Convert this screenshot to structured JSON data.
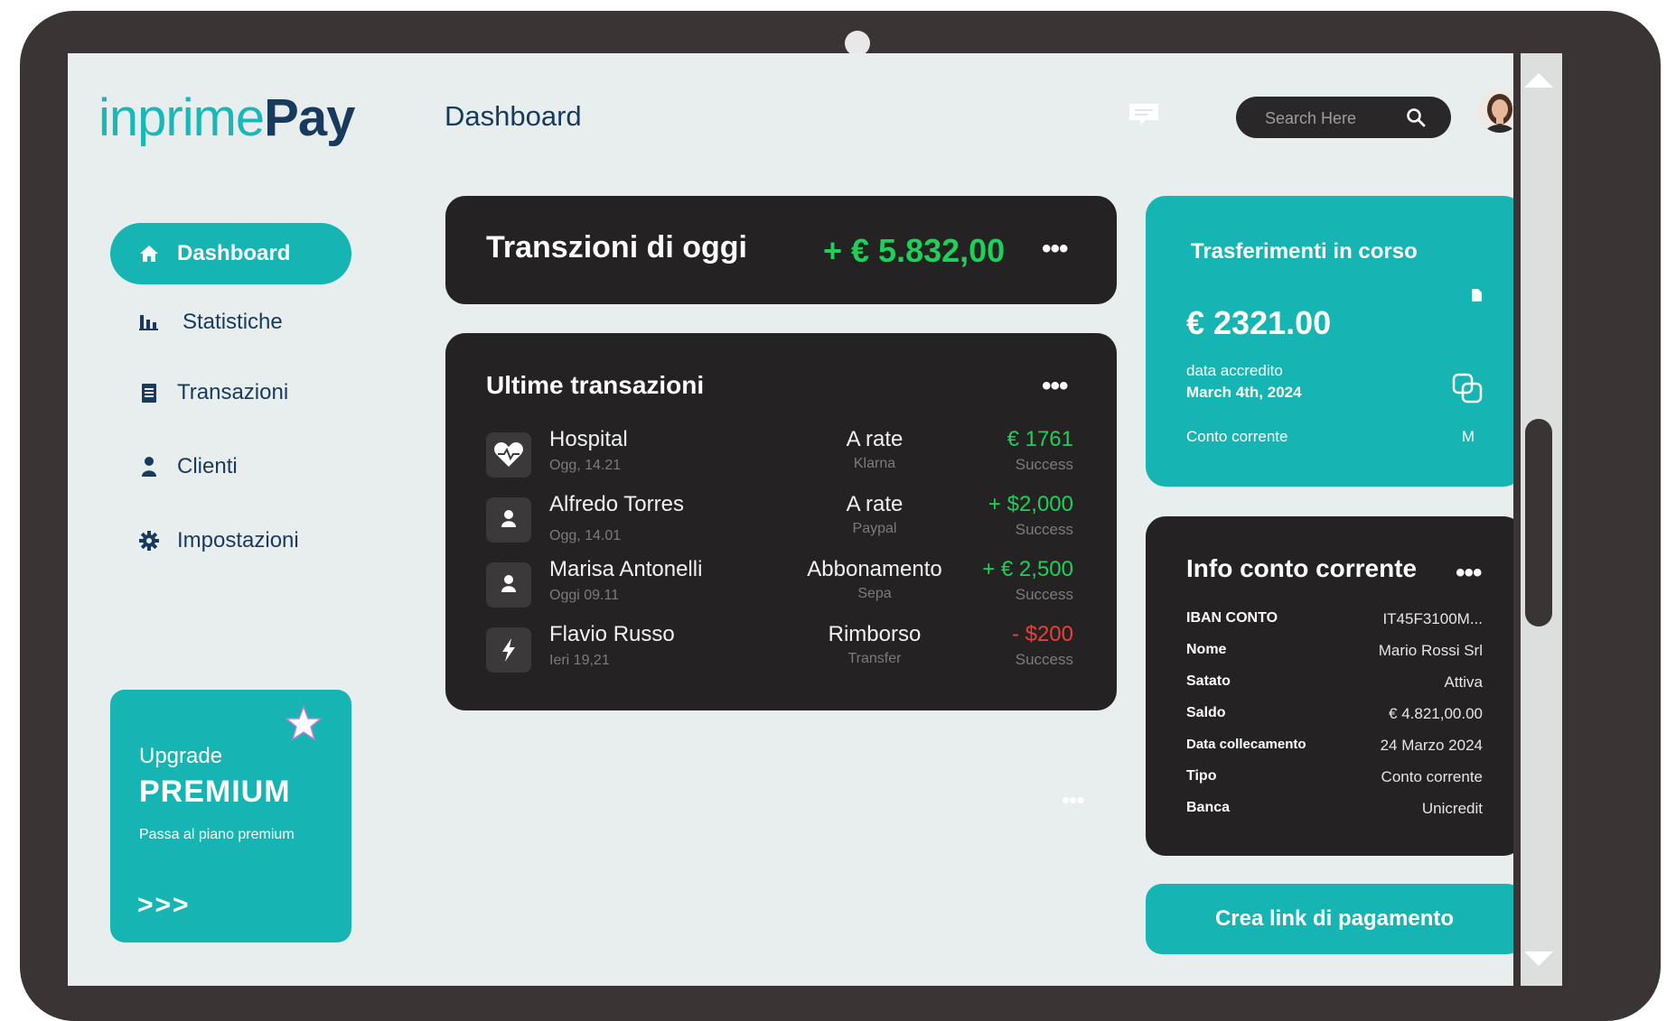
{
  "brand": {
    "part1": "inprime",
    "part2": "Pay"
  },
  "header": {
    "title": "Dashboard",
    "search_placeholder": "Search Here"
  },
  "sidebar": {
    "items": [
      {
        "label": "Dashboard",
        "icon": "home-icon",
        "active": true
      },
      {
        "label": "Statistiche",
        "icon": "bar-chart-icon"
      },
      {
        "label": "Transazioni",
        "icon": "document-icon"
      },
      {
        "label": "Clienti",
        "icon": "user-icon"
      },
      {
        "label": "Impostazioni",
        "icon": "gear-icon"
      }
    ]
  },
  "upgrade": {
    "line1": "Upgrade",
    "line2": "PREMIUM",
    "line3": "Passa al piano premium",
    "arrows": ">>>"
  },
  "today": {
    "title": "Transzioni di oggi",
    "amount": "+ € 5.832,00",
    "more": "•••"
  },
  "recent": {
    "title": "Ultime  transazioni",
    "more": "•••",
    "rows": [
      {
        "icon": "heart-pulse-icon",
        "name": "Hospital",
        "time": "Ogg, 14.21",
        "method": "A rate",
        "provider": "Klarna",
        "amount": "€ 1761",
        "status": "Success",
        "tone": "green"
      },
      {
        "icon": "user-icon",
        "name": "Alfredo Torres",
        "time": "Ogg, 14.01",
        "method": "A rate",
        "provider": "Paypal",
        "amount": "+ $2,000",
        "status": "Success",
        "tone": "green"
      },
      {
        "icon": "user-icon",
        "name": "Marisa Antonelli",
        "time": "Oggi 09.11",
        "method": "Abbonamento",
        "provider": "Sepa",
        "amount": "+ € 2,500",
        "status": "Success",
        "tone": "green"
      },
      {
        "icon": "lightning-icon",
        "name": "Flavio Russo",
        "time": "Ieri 19,21",
        "method": "Rimborso",
        "provider": "Transfer",
        "amount": "- $200",
        "status": "Success",
        "tone": "red"
      }
    ]
  },
  "transfer": {
    "title": "Trasferimenti in corso",
    "amount": "€ 2321.00",
    "date_label": "data accredito",
    "date_value": "March 4th, 2024",
    "account": "Conto corrente",
    "account_code": "M"
  },
  "info": {
    "title": "Info conto corrente",
    "more": "•••",
    "rows": [
      {
        "key": "IBAN CONTO",
        "value": "IT45F3100M..."
      },
      {
        "key": "Nome",
        "value": "Mario Rossi Srl"
      },
      {
        "key": "Satato",
        "value": "Attiva"
      },
      {
        "key": "Saldo",
        "value": "€ 4.821,00.00"
      },
      {
        "key": "Data collecamento",
        "value": "24 Marzo 2024"
      },
      {
        "key": "Tipo",
        "value": "Conto corrente"
      },
      {
        "key": "Banca",
        "value": "Unicredit"
      }
    ]
  },
  "pay_button": "Crea link di pagamento",
  "stray_dots": "•••",
  "colors": {
    "accent": "#16b5b3",
    "dark": "#242222",
    "navy": "#173a5e",
    "positive": "#1fcf5a",
    "negative": "#e8403a"
  }
}
